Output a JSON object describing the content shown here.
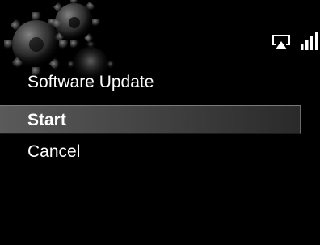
{
  "status": {
    "airplay_icon": "airplay-icon",
    "signal_icon": "signal-strength-icon"
  },
  "dialog": {
    "title": "Software Update",
    "items": [
      {
        "label": "Start",
        "selected": true
      },
      {
        "label": "Cancel",
        "selected": false
      }
    ]
  },
  "colors": {
    "background": "#000000",
    "text": "#ffffff",
    "highlight": "#4a4a4a"
  }
}
